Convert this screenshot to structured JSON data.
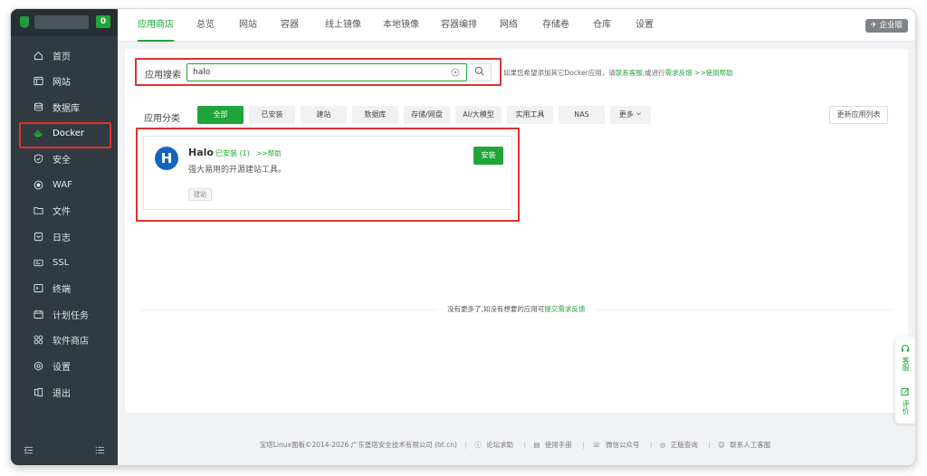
{
  "sidebar": {
    "badge": "0",
    "items": [
      {
        "label": "首页",
        "icon": "home-icon"
      },
      {
        "label": "网站",
        "icon": "website-icon"
      },
      {
        "label": "数据库",
        "icon": "database-icon"
      },
      {
        "label": "Docker",
        "icon": "docker-icon"
      },
      {
        "label": "安全",
        "icon": "shield-icon"
      },
      {
        "label": "WAF",
        "icon": "waf-icon"
      },
      {
        "label": "文件",
        "icon": "folder-icon"
      },
      {
        "label": "日志",
        "icon": "log-icon"
      },
      {
        "label": "SSL",
        "icon": "ssl-icon"
      },
      {
        "label": "终端",
        "icon": "terminal-icon"
      },
      {
        "label": "计划任务",
        "icon": "calendar-icon"
      },
      {
        "label": "软件商店",
        "icon": "store-icon"
      },
      {
        "label": "设置",
        "icon": "gear-icon"
      },
      {
        "label": "退出",
        "icon": "logout-icon"
      }
    ],
    "active": "Docker"
  },
  "tabs": [
    "应用商店",
    "总览",
    "网站",
    "容器",
    "线上镜像",
    "本地镜像",
    "容器编排",
    "网络",
    "存储卷",
    "仓库",
    "设置"
  ],
  "active_tab": "应用商店",
  "enterprise_label": "企业版",
  "search": {
    "label": "应用搜索",
    "value": "halo",
    "hint_prefix": "如果您希望添加其它Docker应用，请",
    "hint_link1": "联系客服",
    "hint_mid": ",或进行",
    "hint_link2": "需求反馈",
    "hint_link3": ">>使用帮助"
  },
  "categories": {
    "label": "应用分类",
    "items": [
      "全部",
      "已安装",
      "建站",
      "数据库",
      "存储/网盘",
      "AI/大模型",
      "实用工具",
      "NAS",
      "更多"
    ],
    "active": "全部",
    "refresh_label": "更新应用列表"
  },
  "app": {
    "logo_letter": "H",
    "name": "Halo",
    "installed": "已安装 (1)",
    "help": ">>帮助",
    "description": "强大易用的开源建站工具。",
    "tag": "建站",
    "install_label": "安装"
  },
  "no_more": {
    "text": "没有更多了,如没有想要的应用可",
    "link": "提交需求反馈"
  },
  "footer": {
    "copyright": "宝塔Linux面板©2014-2026 广东堡塔安全技术有限公司 (bt.cn)",
    "links": [
      "论坛求助",
      "使用手册",
      "微信公众号",
      "正版查询",
      "联系人工客服"
    ]
  },
  "float": {
    "service": "客服",
    "review": "评价"
  },
  "colors": {
    "accent": "#20a53a",
    "sidebar_bg": "#303a40",
    "highlight_red": "#d9342b"
  }
}
